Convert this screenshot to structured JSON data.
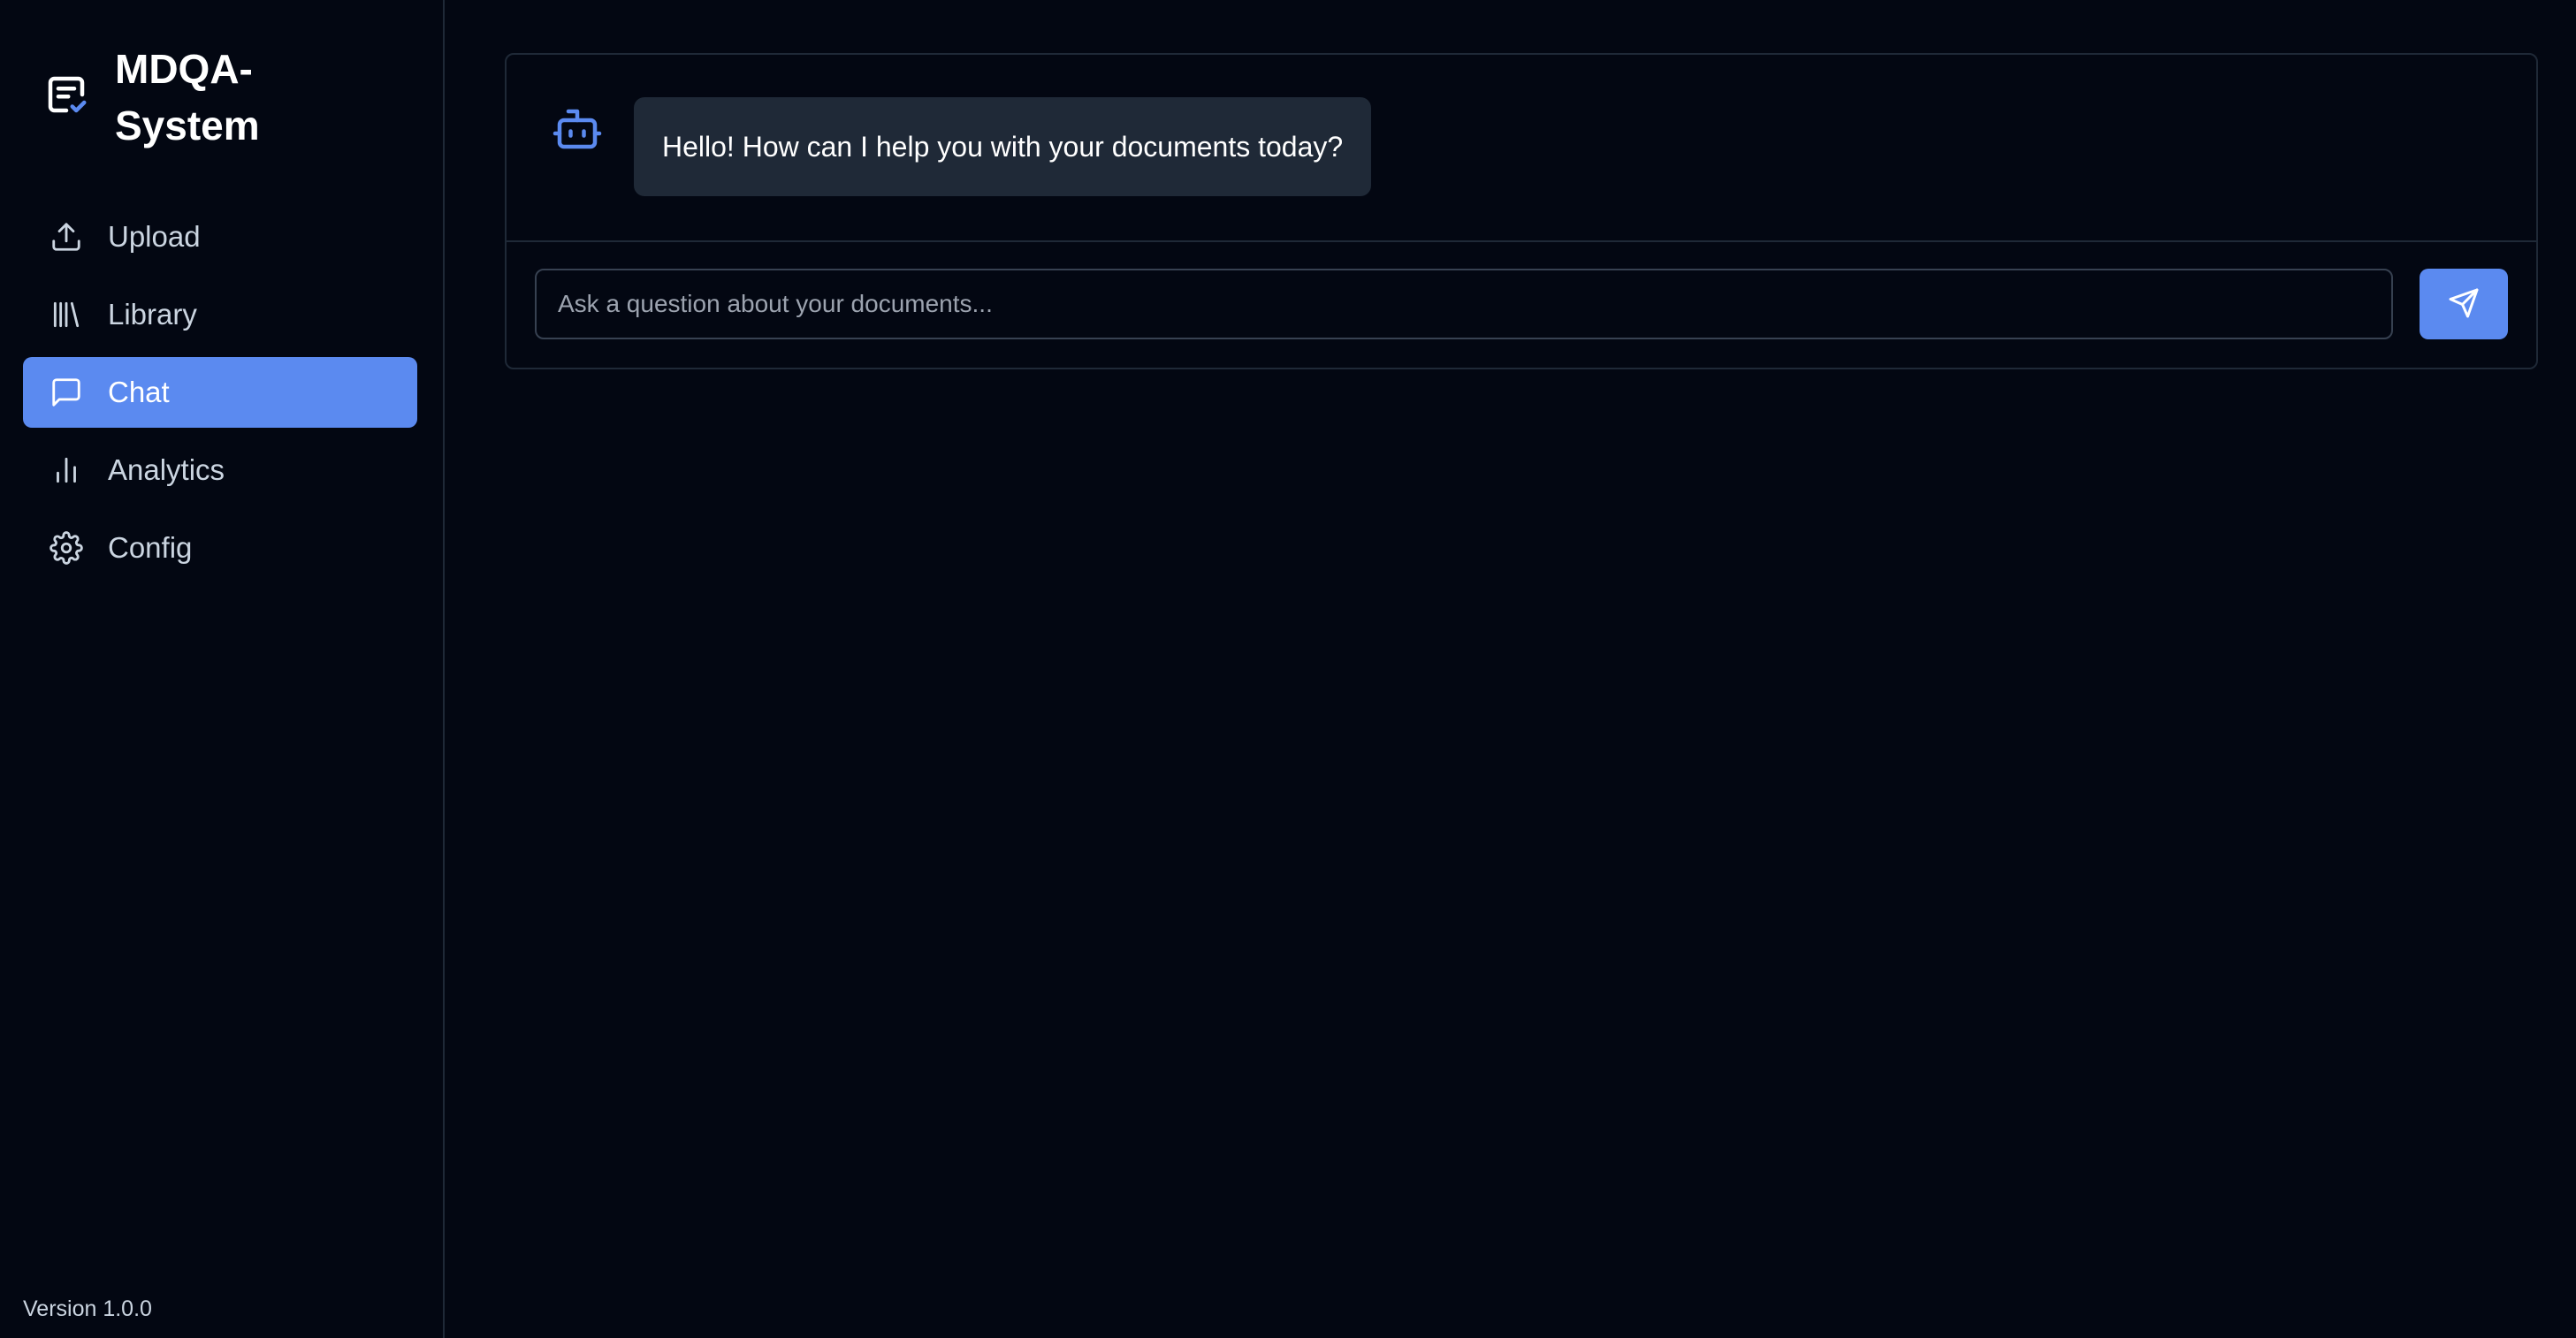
{
  "app": {
    "title": "MDQA-System",
    "version": "Version 1.0.0",
    "accent_color": "#5b8af0"
  },
  "sidebar": {
    "items": [
      {
        "label": "Upload",
        "icon": "upload-icon",
        "active": false
      },
      {
        "label": "Library",
        "icon": "library-icon",
        "active": false
      },
      {
        "label": "Chat",
        "icon": "chat-icon",
        "active": true
      },
      {
        "label": "Analytics",
        "icon": "bar-chart-icon",
        "active": false
      },
      {
        "label": "Config",
        "icon": "gear-icon",
        "active": false
      }
    ]
  },
  "chat": {
    "messages": [
      {
        "role": "bot",
        "text": "Hello! How can I help you with your documents today?"
      }
    ],
    "input_placeholder": "Ask a question about your documents...",
    "input_value": "",
    "send_icon": "send-icon"
  }
}
